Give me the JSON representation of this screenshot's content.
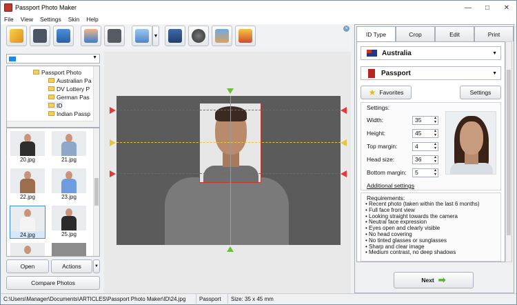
{
  "window": {
    "title": "Passport Photo Maker",
    "controls": [
      "minimize",
      "maximize",
      "close"
    ]
  },
  "menu": [
    "File",
    "View",
    "Settings",
    "Skin",
    "Help"
  ],
  "toolbar": {
    "buttons": [
      "wizard-icon",
      "save-icon",
      "print-icon",
      "user-photo-icon",
      "camera-icon",
      "enhance-icon",
      "help-book-icon",
      "video-icon",
      "share-icon",
      "order-cart-icon"
    ]
  },
  "left_panel": {
    "tree": [
      {
        "label": "Passport Photo"
      },
      {
        "label": "Australian Pa"
      },
      {
        "label": "DV Lottery P"
      },
      {
        "label": "German Pas"
      },
      {
        "label": "ID"
      },
      {
        "label": "Indian Passp"
      }
    ],
    "thumbnails": [
      {
        "caption": "20.jpg",
        "outfit": "#2d2d2d"
      },
      {
        "caption": "21.jpg",
        "outfit": "#8fa7c9"
      },
      {
        "caption": "22.jpg",
        "outfit": "#9d6d4c"
      },
      {
        "caption": "23.jpg",
        "outfit": "#6f9be0"
      },
      {
        "caption": "24.jpg",
        "outfit": "#f4f4f4"
      },
      {
        "caption": "25.jpg",
        "outfit": "#2b2b2b"
      }
    ],
    "open_label": "Open",
    "actions_label": "Actions",
    "compare_label": "Compare Photos"
  },
  "right_panel": {
    "tabs": [
      "ID Type",
      "Crop",
      "Edit",
      "Print"
    ],
    "country": "Australia",
    "document": "Passport",
    "favorites_label": "Favorites",
    "settings_button_label": "Settings",
    "settings_title": "Settings:",
    "fields": [
      {
        "label": "Width:",
        "value": "35"
      },
      {
        "label": "Height:",
        "value": "45"
      },
      {
        "label": "Top margin:",
        "value": "4"
      },
      {
        "label": "Head size:",
        "value": "36"
      },
      {
        "label": "Bottom margin:",
        "value": "5"
      }
    ],
    "additional_settings": "Additional settings",
    "requirements_title": "Requirements:",
    "requirements": [
      "Recent photo (taken within the last 6 months)",
      "Full face front view",
      "Looking straight towards the camera",
      "Neutral face expression",
      "Eyes open and clearly visible",
      "No head covering",
      "No tinted glasses or sunglasses",
      "Sharp and clear image",
      "Medium contrast, no deep shadows"
    ],
    "next_label": "Next"
  },
  "status": {
    "path": "C:\\Users\\Manager\\Documents\\ARTICLES\\Passport Photo Maker\\ID\\24.jpg",
    "doc_type": "Passport",
    "size": "Size: 35 x 45 mm"
  },
  "colors": {
    "guide_red": "#e53935",
    "guide_yellow": "#e7c53b",
    "arrow_green": "#6cbf3b",
    "accent_blue": "#3d8ee0"
  }
}
